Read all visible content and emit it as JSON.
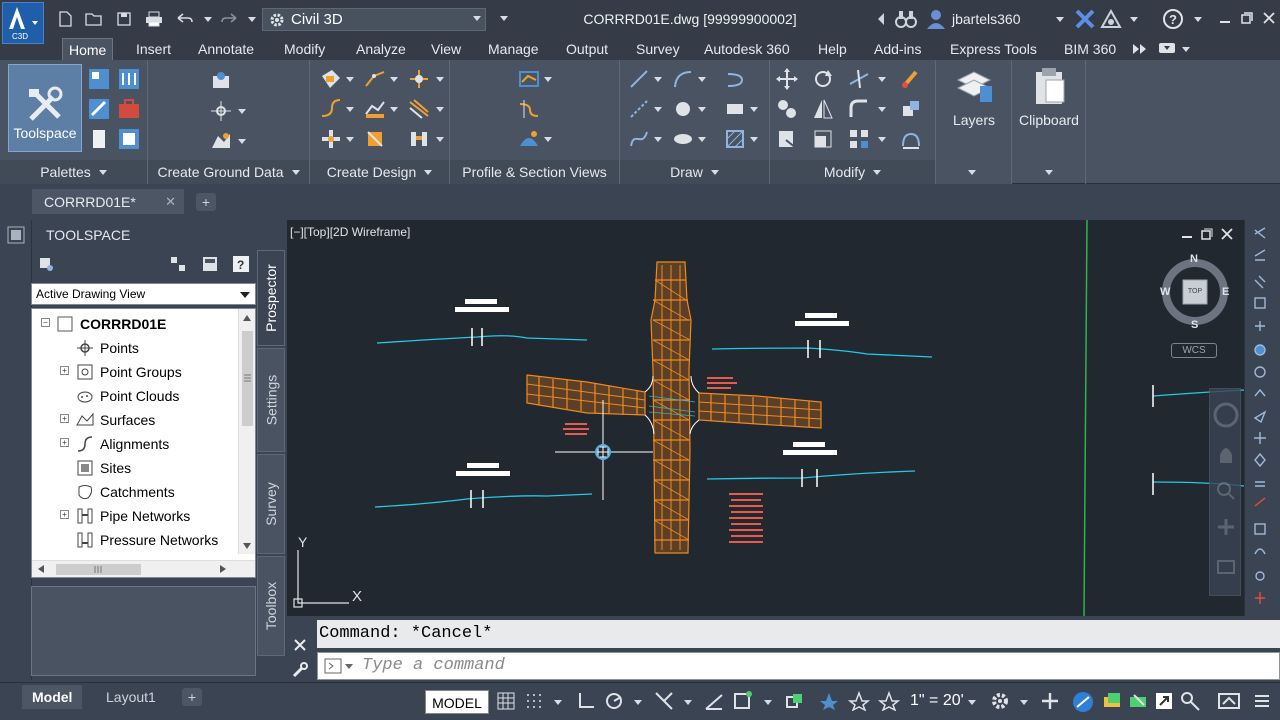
{
  "app": {
    "logo_text": "C3D",
    "workspace": "Civil 3D",
    "document_title": "CORRRD01E.dwg [99999900002]",
    "user": "jbartels360"
  },
  "menu_tabs": [
    {
      "label": "Home",
      "active": true
    },
    {
      "label": "Insert"
    },
    {
      "label": "Annotate"
    },
    {
      "label": "Modify"
    },
    {
      "label": "Analyze"
    },
    {
      "label": "View"
    },
    {
      "label": "Manage"
    },
    {
      "label": "Output"
    },
    {
      "label": "Survey"
    },
    {
      "label": "Autodesk 360"
    },
    {
      "label": "Help"
    },
    {
      "label": "Add-ins"
    },
    {
      "label": "Express Tools"
    },
    {
      "label": "BIM 360"
    }
  ],
  "ribbon": {
    "toolspace_label": "Toolspace",
    "layers_label": "Layers",
    "clipboard_label": "Clipboard",
    "panels": [
      {
        "title": "Palettes"
      },
      {
        "title": "Create Ground Data"
      },
      {
        "title": "Create Design"
      },
      {
        "title": "Profile & Section Views"
      },
      {
        "title": "Draw"
      },
      {
        "title": "Modify"
      }
    ]
  },
  "document_tab": "CORRRD01E*",
  "toolspace": {
    "title": "TOOLSPACE",
    "view_select": "Active Drawing View",
    "tree_root": "CORRRD01E",
    "tree_items": [
      {
        "label": "Points"
      },
      {
        "label": "Point Groups"
      },
      {
        "label": "Point Clouds"
      },
      {
        "label": "Surfaces"
      },
      {
        "label": "Alignments"
      },
      {
        "label": "Sites"
      },
      {
        "label": "Catchments"
      },
      {
        "label": "Pipe Networks"
      },
      {
        "label": "Pressure Networks"
      }
    ],
    "side_tabs": [
      "Prospector",
      "Settings",
      "Survey",
      "Toolbox"
    ]
  },
  "viewport": {
    "label": "[−][Top][2D Wireframe]",
    "cube_top": "TOP",
    "north": "N",
    "south": "S",
    "east": "E",
    "west": "W",
    "wcs": "WCS",
    "axis_x": "X",
    "axis_y": "Y"
  },
  "command": {
    "history": "Command: *Cancel*",
    "placeholder": "Type a command"
  },
  "status": {
    "tabs": [
      {
        "label": "Model",
        "active": true
      },
      {
        "label": "Layout1"
      }
    ],
    "model_button": "MODEL",
    "scale": "1\" = 20'"
  },
  "colors": {
    "corridor": "#f08a1e",
    "alignment": "#28c8e6",
    "background": "#212830",
    "accent": "#1f5ea8"
  }
}
